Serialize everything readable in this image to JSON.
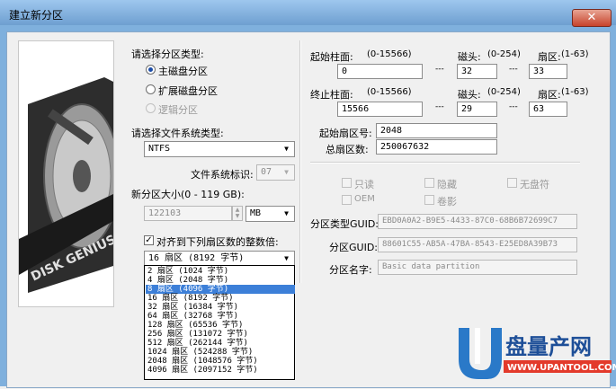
{
  "window": {
    "title": "建立新分区",
    "close_label": "✕"
  },
  "partition_type": {
    "label": "请选择分区类型:",
    "options": [
      "主磁盘分区",
      "扩展磁盘分区",
      "逻辑分区"
    ],
    "selected": 0
  },
  "filesystem": {
    "label": "请选择文件系统类型:",
    "value": "NTFS",
    "id_label": "文件系统标识:",
    "id_value": "07"
  },
  "size": {
    "label": "新分区大小(0 - 119 GB):",
    "value": "122103",
    "unit": "MB"
  },
  "align": {
    "label": "对齐到下列扇区数的整数倍:",
    "checked": true,
    "value": "16 扇区 (8192 字节)",
    "options": [
      "2 扇区 (1024 字节)",
      "4 扇区 (2048 字节)",
      "8 扇区 (4096 字节)",
      "16 扇区 (8192 字节)",
      "32 扇区 (16384 字节)",
      "64 扇区 (32768 字节)",
      "128 扇区 (65536 字节)",
      "256 扇区 (131072 字节)",
      "512 扇区 (262144 字节)",
      "1024 扇区 (524288 字节)",
      "2048 扇区 (1048576 字节)",
      "4096 扇区 (2097152 字节)"
    ],
    "highlighted": 2
  },
  "chs": {
    "start_cyl_label": "起始柱面:",
    "start_cyl_range": "(0-15566)",
    "start_cyl": "0",
    "head_label": "磁头:",
    "head_range": "(0-254)",
    "start_head": "32",
    "sector_label": "扇区:",
    "sector_range": "(1-63)",
    "start_sector": "33",
    "end_cyl_label": "终止柱面:",
    "end_cyl_range": "(0-15566)",
    "end_cyl": "15566",
    "end_head": "29",
    "end_sector": "63",
    "dash": "---"
  },
  "lba": {
    "start_label": "起始扇区号:",
    "start": "2048",
    "count_label": "总扇区数:",
    "count": "250067632"
  },
  "attributes": {
    "readonly": "只读",
    "hidden": "隐藏",
    "no_letter": "无盘符",
    "oem": "OEM",
    "shadow": "卷影"
  },
  "guid": {
    "type_label": "分区类型GUID:",
    "type_value": "EBD0A0A2-B9E5-4433-87C0-68B6B72699C7",
    "part_label": "分区GUID:",
    "part_value": "88601C55-AB5A-47BA-8543-E25ED8A39B73",
    "name_label": "分区名字:",
    "name_value": "Basic data partition"
  },
  "brand": {
    "disk_label": "DISK GENIUS",
    "watermark_text": "盘量产网",
    "watermark_url": "WWW.UPANTOOL.COM"
  }
}
